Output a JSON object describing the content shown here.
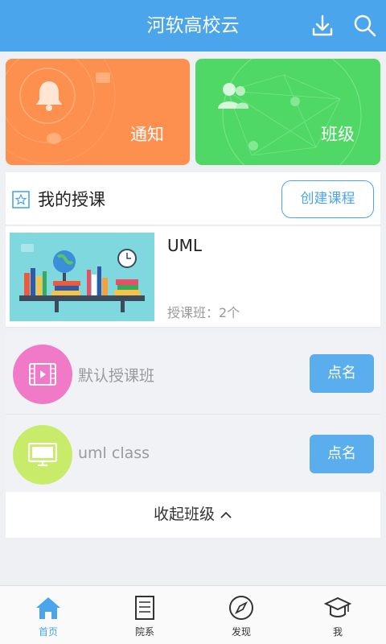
{
  "header": {
    "title": "河软高校云",
    "download_icon": "download-icon",
    "search_icon": "search-icon"
  },
  "cards": [
    {
      "label": "通知",
      "icon": "bell-icon",
      "color": "#fd8f4f"
    },
    {
      "label": "班级",
      "icon": "users-icon",
      "color": "#4fd865"
    }
  ],
  "my_courses": {
    "title": "我的授课",
    "create_label": "创建课程"
  },
  "course": {
    "name": "UML",
    "class_count": "授课班：2个"
  },
  "classes": [
    {
      "name": "默认授课班",
      "action": "点名",
      "icon": "video-icon",
      "color": "#f07ac8"
    },
    {
      "name": "uml class",
      "action": "点名",
      "icon": "monitor-icon",
      "color": "#c8ec6a"
    }
  ],
  "collapse_label": "收起班级",
  "tabs": [
    {
      "label": "首页",
      "icon": "home-icon",
      "active": true
    },
    {
      "label": "院系",
      "icon": "document-icon",
      "active": false
    },
    {
      "label": "发现",
      "icon": "compass-icon",
      "active": false
    },
    {
      "label": "我",
      "icon": "graduation-cap-icon",
      "active": false
    }
  ],
  "colors": {
    "primary": "#4aa5ec",
    "button": "#5aaeee"
  }
}
